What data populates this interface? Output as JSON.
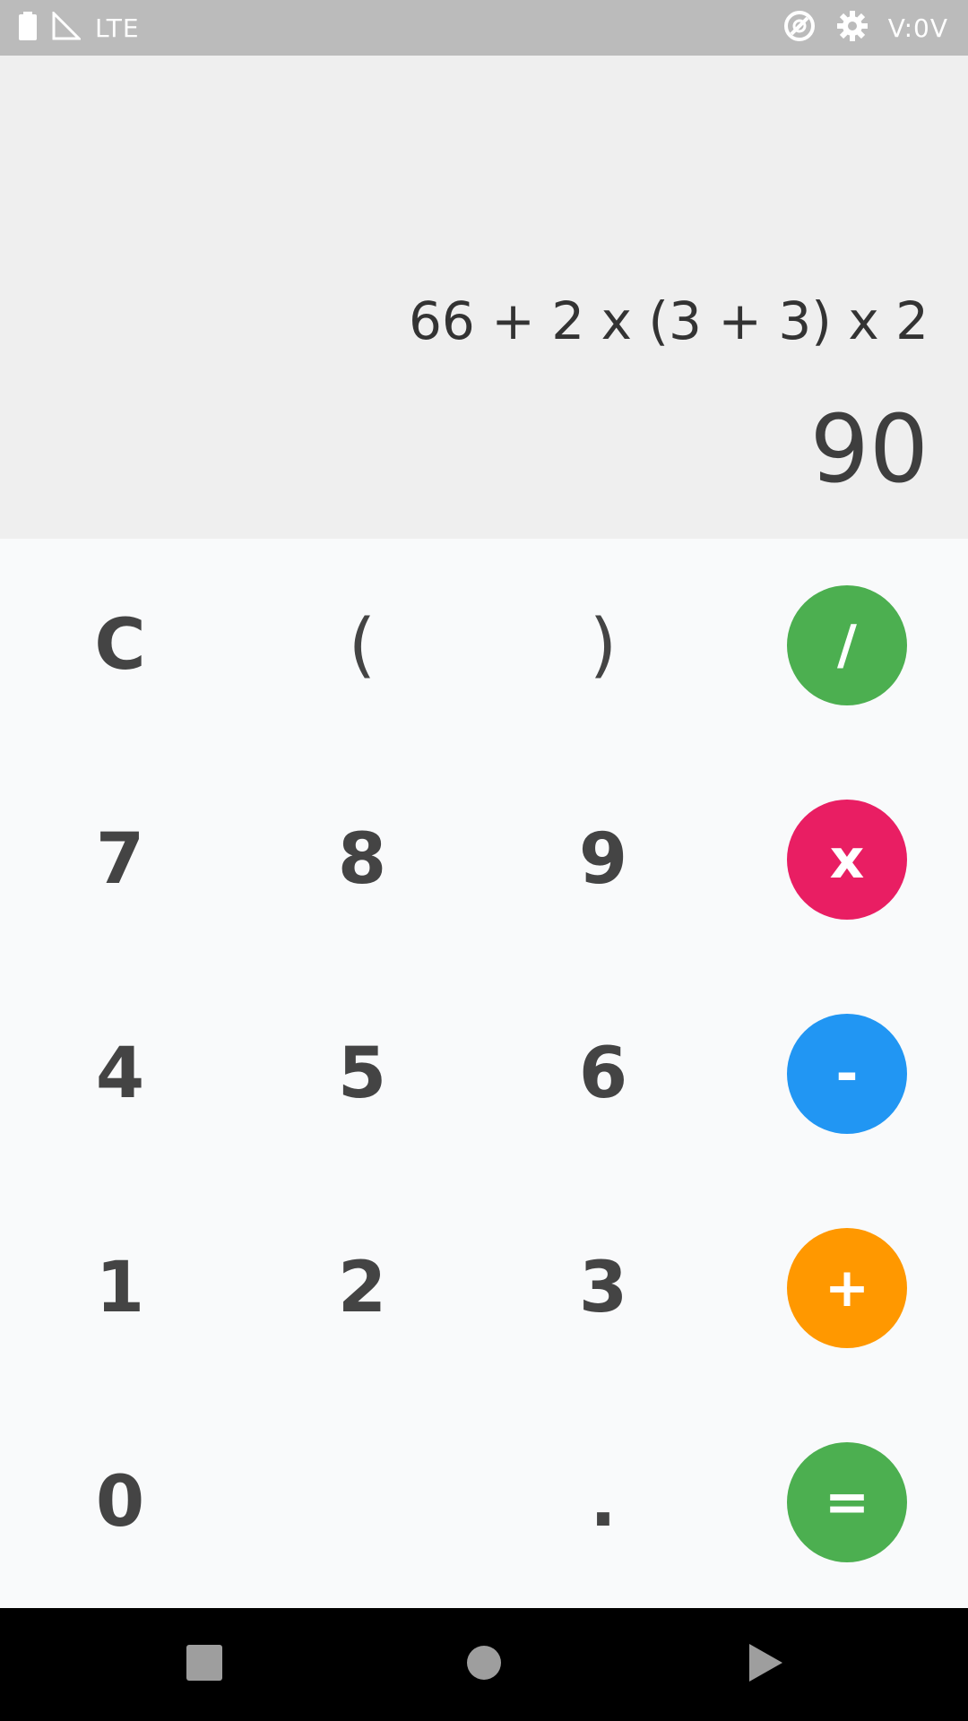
{
  "status_bar": {
    "network": "LTE",
    "time": "V:0V",
    "icons": [
      "battery-icon",
      "signal-icon",
      "data-saver-icon",
      "settings-icon"
    ]
  },
  "display": {
    "expression": "66 + 2 x (3 + 3) x 2",
    "result": "90"
  },
  "keypad": {
    "clear": "C",
    "open_paren": "(",
    "close_paren": ")",
    "divide": "/",
    "multiply": "x",
    "subtract": "-",
    "add": "+",
    "equals": "=",
    "digits": {
      "d0": "0",
      "d1": "1",
      "d2": "2",
      "d3": "3",
      "d4": "4",
      "d5": "5",
      "d6": "6",
      "d7": "7",
      "d8": "8",
      "d9": "9"
    },
    "decimal": "."
  },
  "colors": {
    "divide": "#4caf50",
    "multiply": "#e91e63",
    "subtract": "#2196f3",
    "add": "#ff9800",
    "equals": "#4caf50"
  },
  "nav_bar": {
    "icons": [
      "recents-icon",
      "home-icon",
      "back-icon"
    ]
  }
}
